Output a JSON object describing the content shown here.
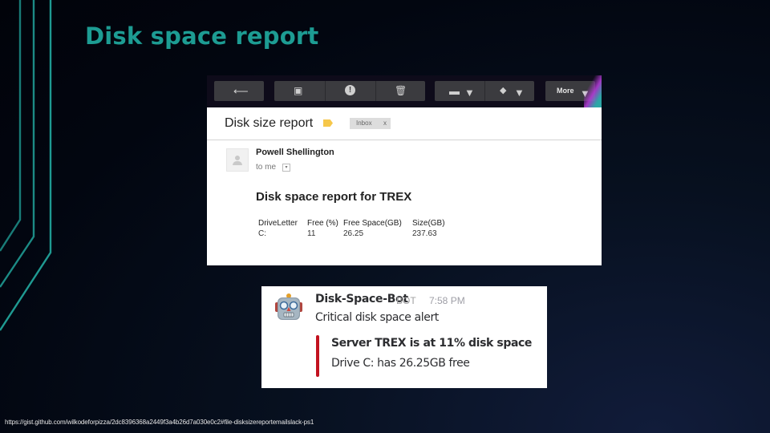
{
  "slide": {
    "title": "Disk space report",
    "source_url": "https://gist.github.com/wilkodeforpizza/2dc8396368a2449f3a4b26d7a030e0c2#file-disksizereportemailslack-ps1",
    "colors": {
      "accent": "#1d9c93",
      "background": "#020610"
    }
  },
  "gmail": {
    "toolbar": {
      "buttons": [
        {
          "icon": "back-arrow-icon",
          "glyph": "⟵"
        },
        {
          "icon": "archive-icon",
          "glyph": "▣"
        },
        {
          "icon": "report-spam-icon",
          "glyph": "!"
        },
        {
          "icon": "trash-icon",
          "glyph": "🗑"
        },
        {
          "icon": "folder-icon",
          "glyph": "▬"
        },
        {
          "icon": "label-icon",
          "glyph": "◆"
        }
      ],
      "more_label": "More",
      "caret": "▼"
    },
    "subject": "Disk size report",
    "label_tag": {
      "text": "Inbox",
      "close": "x",
      "label_color": "#f6c74a"
    },
    "sender": "Powell Shellington",
    "recipient": "to me",
    "recipient_caret": "▾",
    "body": {
      "heading": "Disk space report for TREX",
      "table": {
        "columns": [
          "DriveLetter",
          "Free (%)",
          "Free Space(GB)",
          "Size(GB)"
        ],
        "rows": [
          [
            "C:",
            "11",
            "26.25",
            "237.63"
          ]
        ]
      }
    }
  },
  "slack": {
    "bot_name": "Disk-Space-Bot",
    "bot_badge": "BOT",
    "time": "7:58 PM",
    "message": "Critical disk space alert",
    "attachment": {
      "color": "#c2121f",
      "title": "Server TREX is at 11% disk space",
      "text": "Drive C: has 26.25GB free"
    }
  }
}
